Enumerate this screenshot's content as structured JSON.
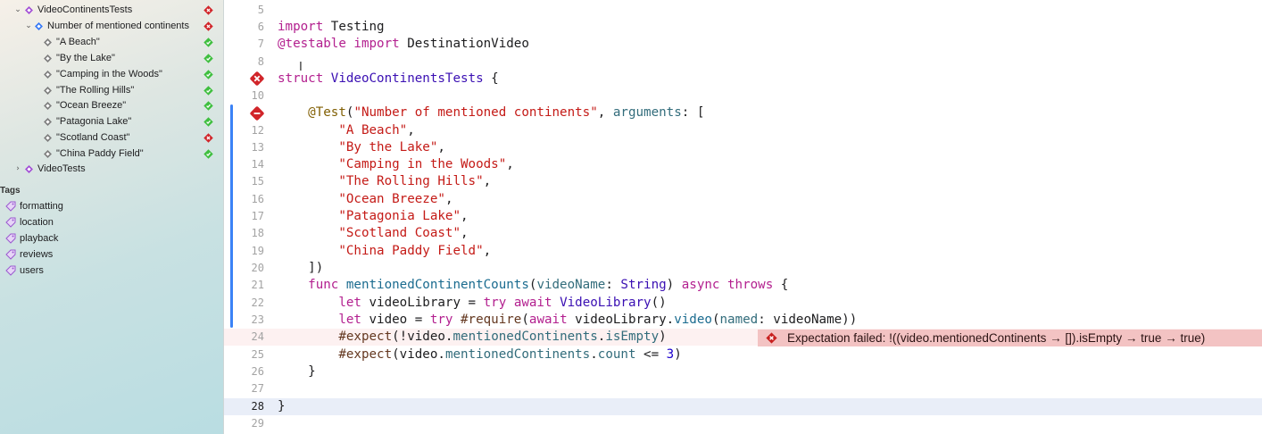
{
  "sidebar": {
    "suite": {
      "label": "VideoContinentsTests",
      "status": "fail"
    },
    "test": {
      "label": "Number of mentioned continents",
      "status": "fail"
    },
    "arguments": [
      {
        "label": "\"A Beach\"",
        "status": "pass"
      },
      {
        "label": "\"By the Lake\"",
        "status": "pass"
      },
      {
        "label": "\"Camping in the Woods\"",
        "status": "pass"
      },
      {
        "label": "\"The Rolling Hills\"",
        "status": "pass"
      },
      {
        "label": "\"Ocean Breeze\"",
        "status": "pass"
      },
      {
        "label": "\"Patagonia Lake\"",
        "status": "pass"
      },
      {
        "label": "\"Scotland Coast\"",
        "status": "fail"
      },
      {
        "label": "\"China Paddy Field\"",
        "status": "pass"
      }
    ],
    "other_suite": {
      "label": "VideoTests"
    },
    "tags_heading": "Tags",
    "tags": [
      "formatting",
      "location",
      "playback",
      "reviews",
      "users"
    ]
  },
  "editor": {
    "line_numbers": [
      "5",
      "6",
      "7",
      "8",
      "9",
      "10",
      "11",
      "12",
      "13",
      "14",
      "15",
      "16",
      "17",
      "18",
      "19",
      "20",
      "21",
      "22",
      "23",
      "24",
      "25",
      "26",
      "27",
      "28",
      "29"
    ],
    "current_line": "28",
    "error_line": "24",
    "error_message": "Expectation failed: !((video.mentionedContinents → []).isEmpty → true → true)"
  },
  "colors": {
    "accent": "#3b82f6",
    "fail": "#d1252a",
    "pass": "#3fbf3f",
    "error_banner": "#f3c3c3"
  }
}
